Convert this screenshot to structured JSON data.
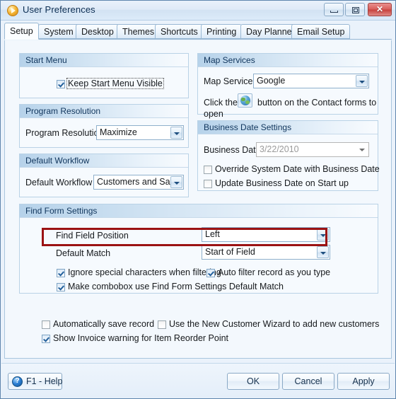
{
  "window": {
    "title": "User Preferences",
    "app_icon": "play-circle-icon",
    "controls": {
      "minimize": "minimize-icon",
      "maximize": "maximize-icon",
      "close": "✕"
    }
  },
  "tabs": [
    {
      "label": "Setup",
      "active": true
    },
    {
      "label": "System",
      "active": false
    },
    {
      "label": "Desktop",
      "active": false
    },
    {
      "label": "Themes",
      "active": false
    },
    {
      "label": "Shortcuts",
      "active": false
    },
    {
      "label": "Printing",
      "active": false
    },
    {
      "label": "Day Planner",
      "active": false
    },
    {
      "label": "Email Setup",
      "active": false
    }
  ],
  "groups": {
    "start_menu": {
      "title": "Start Menu",
      "keep_visible": {
        "label": "Keep Start Menu Visible",
        "checked": true,
        "focused": true
      }
    },
    "program_resolution": {
      "title": "Program Resolution",
      "field_label": "Program Resolution",
      "value": "Maximize"
    },
    "default_workflow": {
      "title": "Default Workflow",
      "field_label": "Default Workflow",
      "value": "Customers and Sales"
    },
    "map_services": {
      "title": "Map Services",
      "field_label": "Map Service",
      "value": "Google",
      "hint_before": "Click the",
      "hint_after": "button on the Contact forms to",
      "hint_line2": "open",
      "globe_icon": "globe-icon"
    },
    "business_date": {
      "title": "Business Date Settings",
      "field_label": "Business Date",
      "value": "3/22/2010",
      "disabled": true,
      "override_system_date": {
        "label": "Override System Date with Business Date",
        "checked": false
      },
      "update_on_startup": {
        "label": "Update Business Date on Start up",
        "checked": false
      }
    },
    "find_form": {
      "title": "Find Form Settings",
      "find_field_position": {
        "label": "Find Field Position",
        "value": "Left"
      },
      "default_match": {
        "label": "Default Match",
        "value": "Start of Field"
      },
      "ignore_special": {
        "label": "Ignore special characters when filtering",
        "checked": true
      },
      "auto_filter": {
        "label": "Auto filter record as you type",
        "checked": true
      },
      "combobox_match": {
        "label": "Make combobox use Find Form Settings Default Match",
        "checked": true
      }
    }
  },
  "bottom_options": {
    "auto_save": {
      "label": "Automatically save record",
      "checked": false
    },
    "new_cust_wizard": {
      "label": "Use the New Customer Wizard to add new customers",
      "checked": false
    },
    "invoice_warning": {
      "label": "Show Invoice warning for Item Reorder Point",
      "checked": true
    }
  },
  "footer": {
    "help": "F1 - Help",
    "help_icon": "question-circle-icon",
    "ok": "OK",
    "cancel": "Cancel",
    "apply": "Apply"
  },
  "colors": {
    "highlight": "#9b1213",
    "title_text": "#0b2d52",
    "group_header_start": "#b6d2ea",
    "close_button": "#c8423e"
  }
}
